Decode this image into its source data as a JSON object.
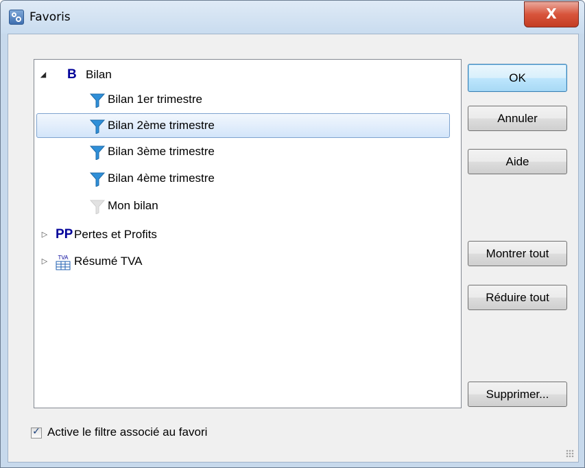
{
  "window": {
    "title": "Favoris",
    "close_glyph": "X",
    "colors": {
      "selection": "#d3e5fa",
      "accent_blue": "#000099",
      "funnel_blue": "#2f8fd8"
    }
  },
  "tree": {
    "items": [
      {
        "label": "Bilan",
        "badge": "B",
        "expanded": true,
        "icon": "letter-b-icon"
      },
      {
        "label": "Bilan 1er trimestre",
        "icon": "funnel-icon"
      },
      {
        "label": "Bilan 2ème trimestre",
        "icon": "funnel-icon",
        "selected": true
      },
      {
        "label": "Bilan 3ème trimestre",
        "icon": "funnel-icon"
      },
      {
        "label": "Bilan 4ème trimestre",
        "icon": "funnel-icon"
      },
      {
        "label": "Mon bilan",
        "icon": "funnel-grey-icon"
      },
      {
        "label": "Pertes et Profits",
        "badge": "PP",
        "expanded": false,
        "icon": "letters-pp-icon"
      },
      {
        "label": "Résumé TVA",
        "badge": "TVA",
        "expanded": false,
        "icon": "tva-table-icon"
      }
    ]
  },
  "buttons": {
    "ok": "OK",
    "cancel": "Annuler",
    "help": "Aide",
    "show_all": "Montrer tout",
    "collapse_all": "Réduire tout",
    "delete": "Supprimer..."
  },
  "checkbox": {
    "label": "Active le filtre associé au favori",
    "checked": true,
    "glyph": "✓"
  }
}
